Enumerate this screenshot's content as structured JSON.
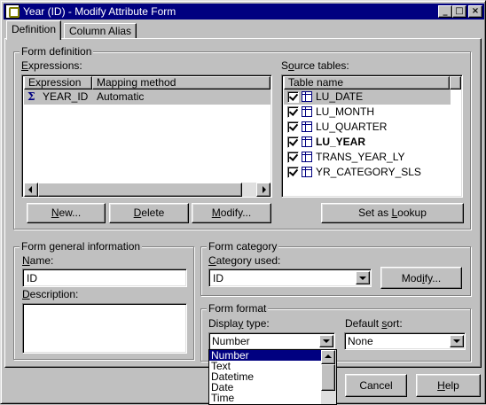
{
  "window": {
    "title": "Year (ID) - Modify Attribute Form",
    "controls": {
      "minimize": "_",
      "maximize": "□",
      "close": "×"
    }
  },
  "tabs": [
    {
      "label": "Definition",
      "active": true
    },
    {
      "label": "Column Alias",
      "active": false
    }
  ],
  "form_definition": {
    "legend": "Form definition",
    "expressions_label": "Expressions:",
    "expressions_columns": [
      "Expression",
      "Mapping method"
    ],
    "expressions_rows": [
      {
        "icon": "sigma-icon",
        "expression": "YEAR_ID",
        "mapping": "Automatic"
      }
    ],
    "source_tables_label": "Source tables:",
    "source_tables_column": "Table name",
    "source_tables": [
      {
        "name": "LU_DATE",
        "checked": true,
        "bold": false,
        "selected": true
      },
      {
        "name": "LU_MONTH",
        "checked": true,
        "bold": false,
        "selected": false
      },
      {
        "name": "LU_QUARTER",
        "checked": true,
        "bold": false,
        "selected": false
      },
      {
        "name": "LU_YEAR",
        "checked": true,
        "bold": true,
        "selected": false
      },
      {
        "name": "TRANS_YEAR_LY",
        "checked": true,
        "bold": false,
        "selected": false
      },
      {
        "name": "YR_CATEGORY_SLS",
        "checked": true,
        "bold": false,
        "selected": false
      }
    ],
    "buttons": {
      "new": "New...",
      "delete": "Delete",
      "modify": "Modify...",
      "set_lookup": "Set as Lookup"
    }
  },
  "general_info": {
    "legend": "Form general information",
    "name_label": "Name:",
    "name_value": "ID",
    "description_label": "Description:",
    "description_value": ""
  },
  "category": {
    "legend": "Form category",
    "category_label": "Category used:",
    "category_value": "ID",
    "modify_button": "Modify..."
  },
  "format": {
    "legend": "Form format",
    "display_type_label": "Display type:",
    "display_type_value": "Number",
    "default_sort_label": "Default sort:",
    "default_sort_value": "None",
    "display_type_options": [
      "Number",
      "Text",
      "Datetime",
      "Date",
      "Time"
    ]
  },
  "footer": {
    "cancel": "Cancel",
    "help": "Help"
  },
  "colors": {
    "title_bar": "#000080",
    "face": "#c0c0c0",
    "selection": "#000080",
    "row_highlight": "#c0c0c0"
  }
}
